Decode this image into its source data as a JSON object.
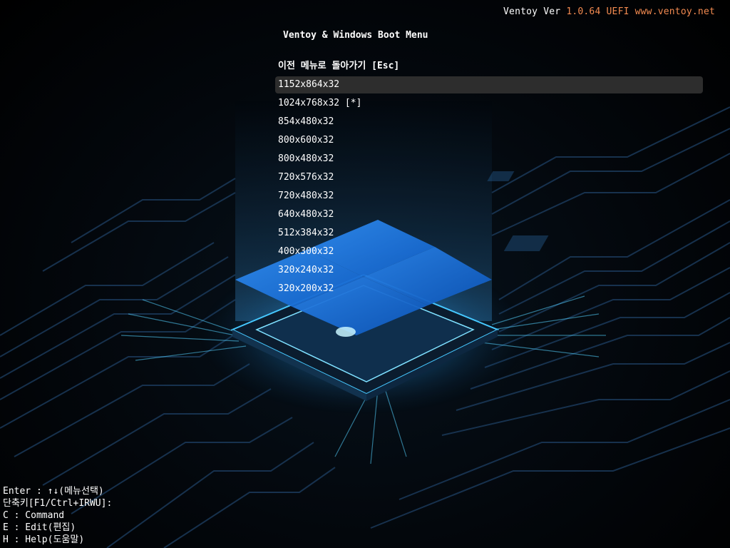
{
  "header": {
    "product_label": "Ventoy Ver ",
    "version": "1.0.64 UEFI",
    "website": "www.ventoy.net"
  },
  "menu": {
    "title": "Ventoy & Windows Boot Menu",
    "back_item": "이전 메뉴로 돌아가기 [Esc]",
    "selected_index": 0,
    "items": [
      "1152x864x32",
      "1024x768x32 [*]",
      "854x480x32",
      "800x600x32",
      "800x480x32",
      "720x576x32",
      "720x480x32",
      "640x480x32",
      "512x384x32",
      "400x300x32",
      "320x240x32",
      "320x200x32"
    ]
  },
  "help": {
    "lines": [
      "Enter : ↑↓(메뉴선택)",
      "단축키[F1/Ctrl+IRWU]:",
      "C : Command",
      "E : Edit(편집)",
      "H : Help(도움말)"
    ]
  },
  "colors": {
    "version_accent": "#f28a50",
    "selection_bg": "#2d2d2d",
    "text": "#ffffff",
    "glow": "#39c6ff",
    "windows_blue": "#1f7be0"
  },
  "icons": {
    "background": "windows-chip-circuit-wallpaper"
  }
}
